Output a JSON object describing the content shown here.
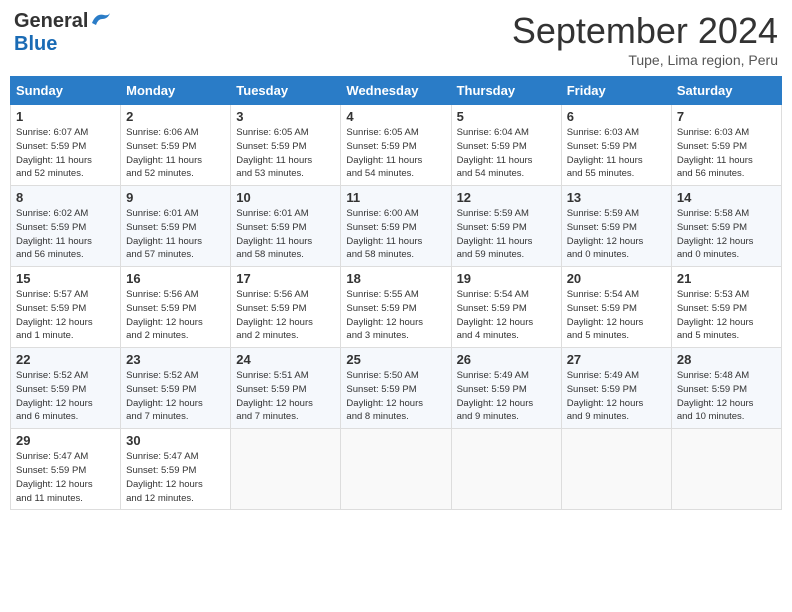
{
  "header": {
    "logo_general": "General",
    "logo_blue": "Blue",
    "month_title": "September 2024",
    "location": "Tupe, Lima region, Peru"
  },
  "calendar": {
    "headers": [
      "Sunday",
      "Monday",
      "Tuesday",
      "Wednesday",
      "Thursday",
      "Friday",
      "Saturday"
    ],
    "rows": [
      [
        {
          "day": "1",
          "info": "Sunrise: 6:07 AM\nSunset: 5:59 PM\nDaylight: 11 hours\nand 52 minutes."
        },
        {
          "day": "2",
          "info": "Sunrise: 6:06 AM\nSunset: 5:59 PM\nDaylight: 11 hours\nand 52 minutes."
        },
        {
          "day": "3",
          "info": "Sunrise: 6:05 AM\nSunset: 5:59 PM\nDaylight: 11 hours\nand 53 minutes."
        },
        {
          "day": "4",
          "info": "Sunrise: 6:05 AM\nSunset: 5:59 PM\nDaylight: 11 hours\nand 54 minutes."
        },
        {
          "day": "5",
          "info": "Sunrise: 6:04 AM\nSunset: 5:59 PM\nDaylight: 11 hours\nand 54 minutes."
        },
        {
          "day": "6",
          "info": "Sunrise: 6:03 AM\nSunset: 5:59 PM\nDaylight: 11 hours\nand 55 minutes."
        },
        {
          "day": "7",
          "info": "Sunrise: 6:03 AM\nSunset: 5:59 PM\nDaylight: 11 hours\nand 56 minutes."
        }
      ],
      [
        {
          "day": "8",
          "info": "Sunrise: 6:02 AM\nSunset: 5:59 PM\nDaylight: 11 hours\nand 56 minutes."
        },
        {
          "day": "9",
          "info": "Sunrise: 6:01 AM\nSunset: 5:59 PM\nDaylight: 11 hours\nand 57 minutes."
        },
        {
          "day": "10",
          "info": "Sunrise: 6:01 AM\nSunset: 5:59 PM\nDaylight: 11 hours\nand 58 minutes."
        },
        {
          "day": "11",
          "info": "Sunrise: 6:00 AM\nSunset: 5:59 PM\nDaylight: 11 hours\nand 58 minutes."
        },
        {
          "day": "12",
          "info": "Sunrise: 5:59 AM\nSunset: 5:59 PM\nDaylight: 11 hours\nand 59 minutes."
        },
        {
          "day": "13",
          "info": "Sunrise: 5:59 AM\nSunset: 5:59 PM\nDaylight: 12 hours\nand 0 minutes."
        },
        {
          "day": "14",
          "info": "Sunrise: 5:58 AM\nSunset: 5:59 PM\nDaylight: 12 hours\nand 0 minutes."
        }
      ],
      [
        {
          "day": "15",
          "info": "Sunrise: 5:57 AM\nSunset: 5:59 PM\nDaylight: 12 hours\nand 1 minute."
        },
        {
          "day": "16",
          "info": "Sunrise: 5:56 AM\nSunset: 5:59 PM\nDaylight: 12 hours\nand 2 minutes."
        },
        {
          "day": "17",
          "info": "Sunrise: 5:56 AM\nSunset: 5:59 PM\nDaylight: 12 hours\nand 2 minutes."
        },
        {
          "day": "18",
          "info": "Sunrise: 5:55 AM\nSunset: 5:59 PM\nDaylight: 12 hours\nand 3 minutes."
        },
        {
          "day": "19",
          "info": "Sunrise: 5:54 AM\nSunset: 5:59 PM\nDaylight: 12 hours\nand 4 minutes."
        },
        {
          "day": "20",
          "info": "Sunrise: 5:54 AM\nSunset: 5:59 PM\nDaylight: 12 hours\nand 5 minutes."
        },
        {
          "day": "21",
          "info": "Sunrise: 5:53 AM\nSunset: 5:59 PM\nDaylight: 12 hours\nand 5 minutes."
        }
      ],
      [
        {
          "day": "22",
          "info": "Sunrise: 5:52 AM\nSunset: 5:59 PM\nDaylight: 12 hours\nand 6 minutes."
        },
        {
          "day": "23",
          "info": "Sunrise: 5:52 AM\nSunset: 5:59 PM\nDaylight: 12 hours\nand 7 minutes."
        },
        {
          "day": "24",
          "info": "Sunrise: 5:51 AM\nSunset: 5:59 PM\nDaylight: 12 hours\nand 7 minutes."
        },
        {
          "day": "25",
          "info": "Sunrise: 5:50 AM\nSunset: 5:59 PM\nDaylight: 12 hours\nand 8 minutes."
        },
        {
          "day": "26",
          "info": "Sunrise: 5:49 AM\nSunset: 5:59 PM\nDaylight: 12 hours\nand 9 minutes."
        },
        {
          "day": "27",
          "info": "Sunrise: 5:49 AM\nSunset: 5:59 PM\nDaylight: 12 hours\nand 9 minutes."
        },
        {
          "day": "28",
          "info": "Sunrise: 5:48 AM\nSunset: 5:59 PM\nDaylight: 12 hours\nand 10 minutes."
        }
      ],
      [
        {
          "day": "29",
          "info": "Sunrise: 5:47 AM\nSunset: 5:59 PM\nDaylight: 12 hours\nand 11 minutes."
        },
        {
          "day": "30",
          "info": "Sunrise: 5:47 AM\nSunset: 5:59 PM\nDaylight: 12 hours\nand 12 minutes."
        },
        {
          "day": "",
          "info": ""
        },
        {
          "day": "",
          "info": ""
        },
        {
          "day": "",
          "info": ""
        },
        {
          "day": "",
          "info": ""
        },
        {
          "day": "",
          "info": ""
        }
      ]
    ]
  }
}
